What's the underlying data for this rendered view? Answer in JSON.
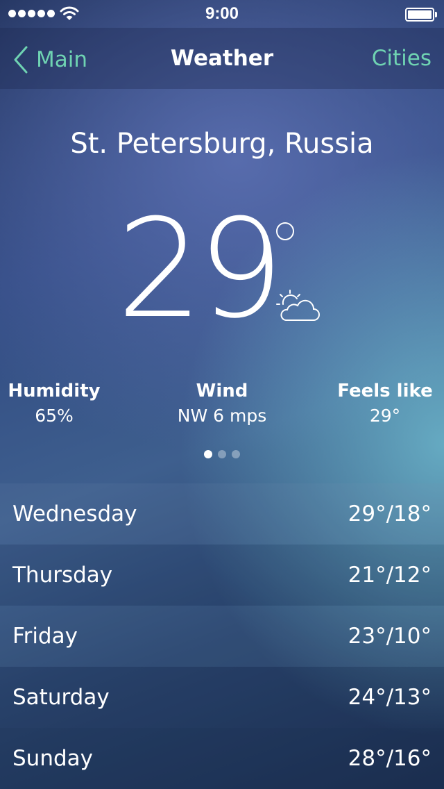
{
  "status_bar": {
    "time": "9:00",
    "signal_bars": 5
  },
  "nav": {
    "back_label": "Main",
    "title": "Weather",
    "right_label": "Cities"
  },
  "location": "St. Petersburg, Russia",
  "temperature": "29",
  "condition_icon": "partly-sunny-icon",
  "details": {
    "humidity_label": "Humidity",
    "humidity_value": "65%",
    "wind_label": "Wind",
    "wind_value": "NW 6 mps",
    "feels_label": "Feels like",
    "feels_value": "29°"
  },
  "pager": {
    "count": 3,
    "active": 0
  },
  "forecast": [
    {
      "day": "Wednesday",
      "temps": "29°/18°"
    },
    {
      "day": "Thursday",
      "temps": "21°/12°"
    },
    {
      "day": "Friday",
      "temps": "23°/10°"
    },
    {
      "day": "Saturday",
      "temps": "24°/13°"
    },
    {
      "day": "Sunday",
      "temps": "28°/16°"
    }
  ],
  "colors": {
    "accent": "#6fd3b2",
    "text": "#ffffff"
  }
}
